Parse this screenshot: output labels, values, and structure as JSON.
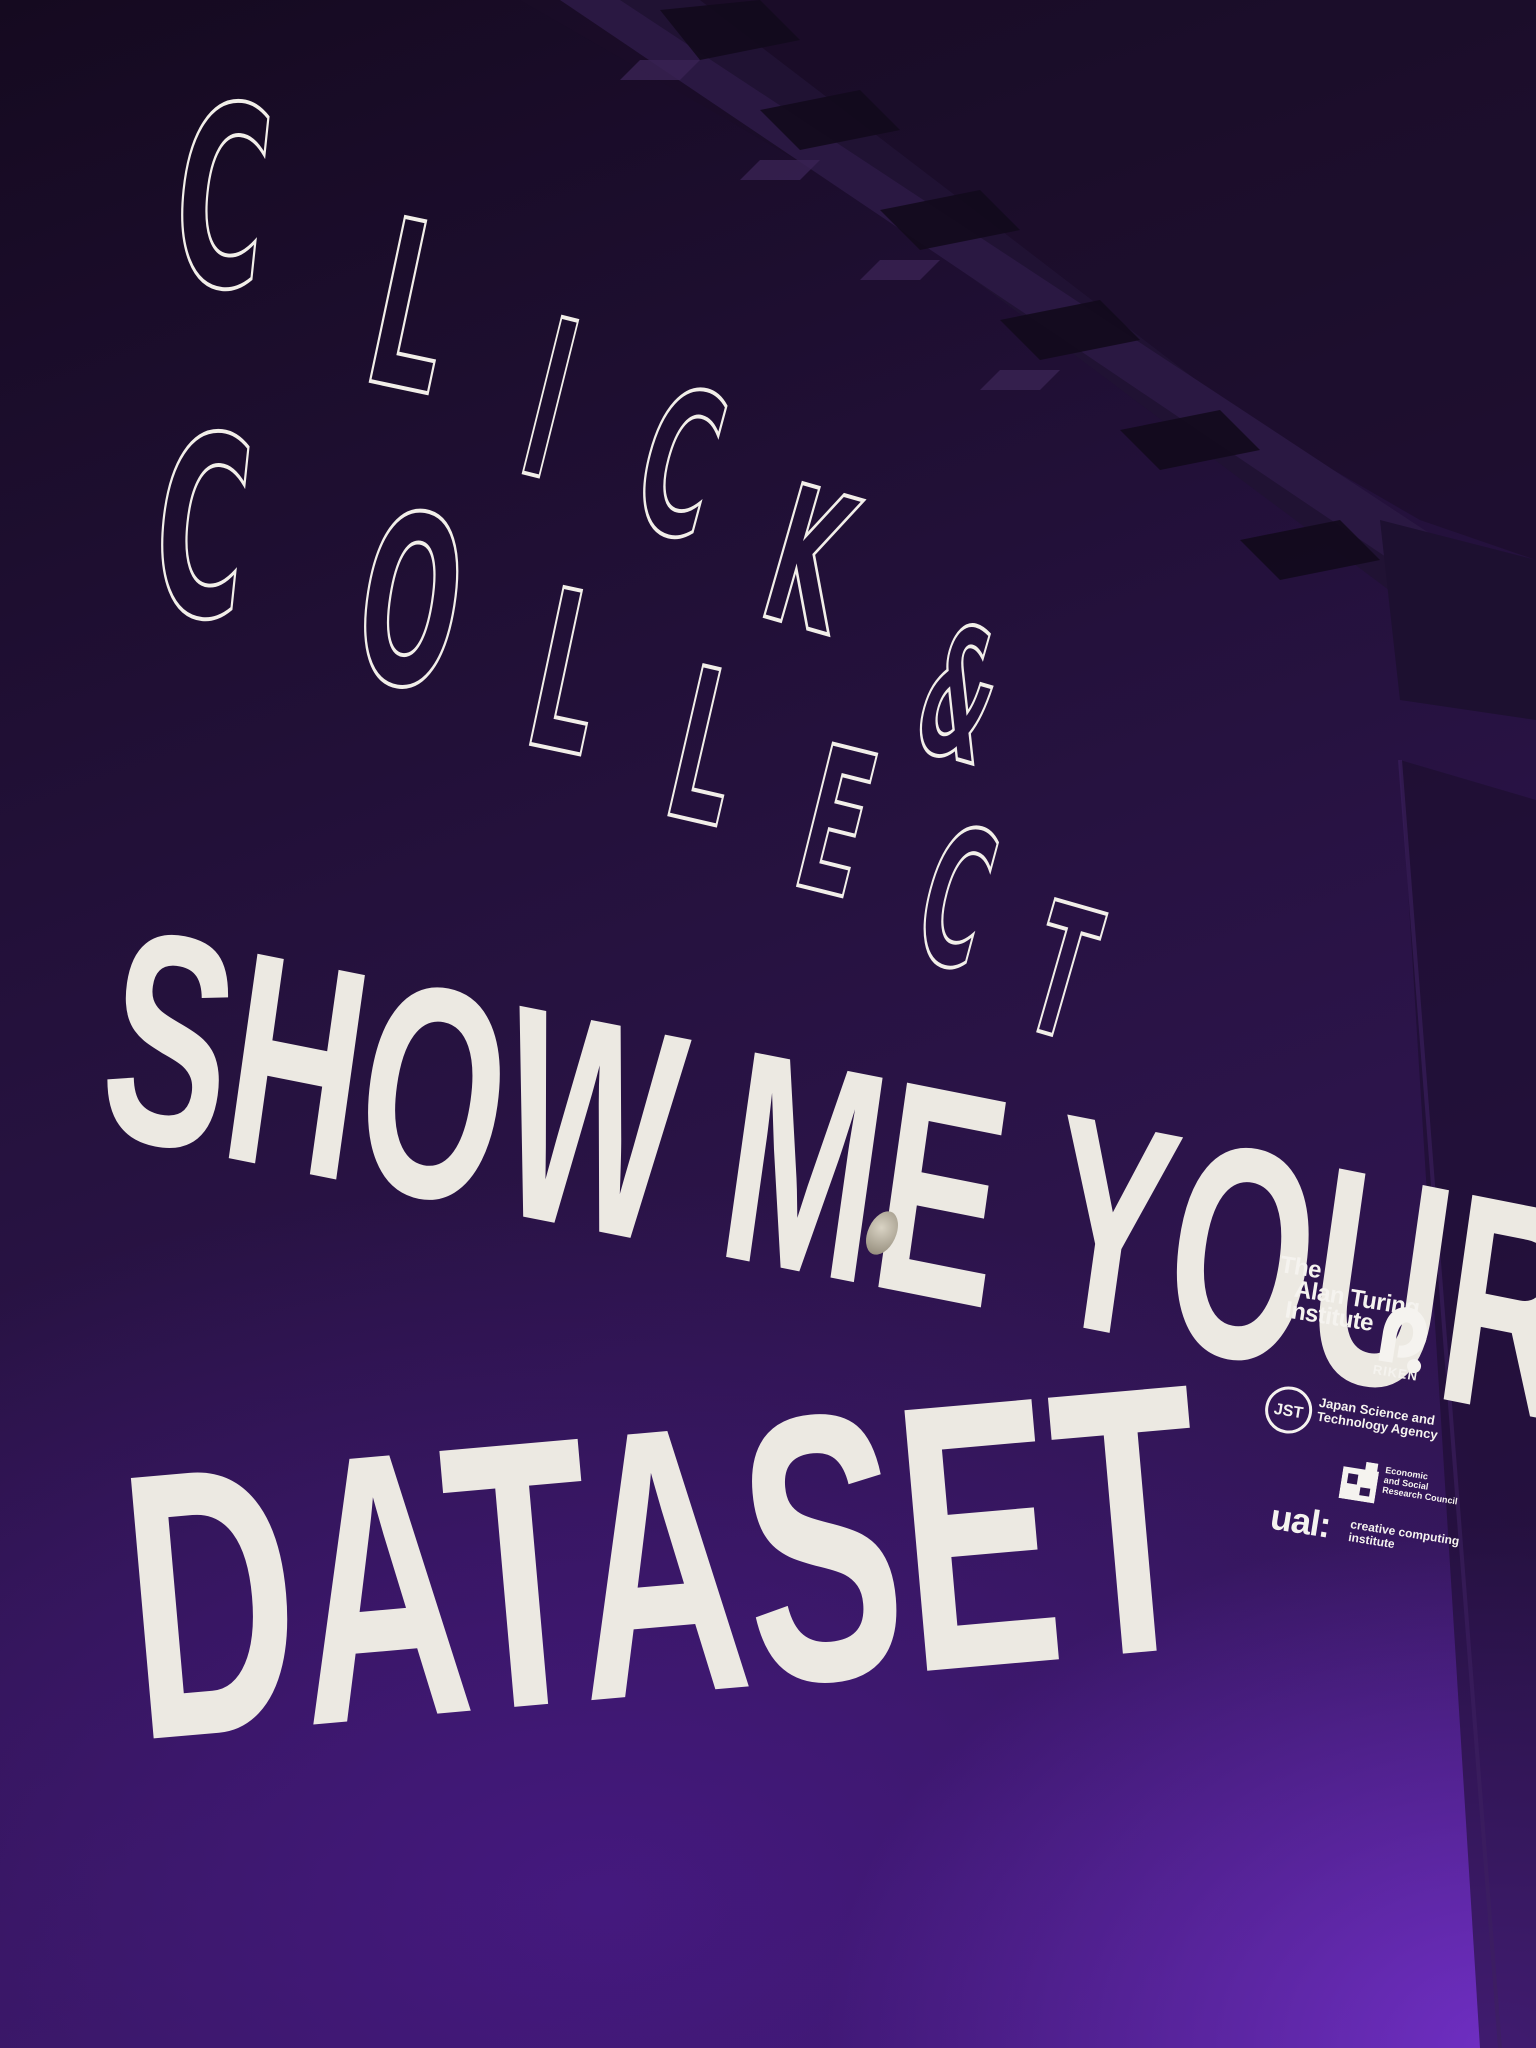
{
  "headline": {
    "outline_line1": [
      "C",
      "L",
      "I",
      "C",
      "K",
      "&"
    ],
    "outline_line2": [
      "C",
      "O",
      "L",
      "L",
      "E",
      "C",
      "T"
    ],
    "solid_line1": "SHOW ME YOUR",
    "solid_line2": "DATASET"
  },
  "logos": {
    "turing": [
      "The",
      "Alan Turing",
      "Institute"
    ],
    "riken": "RIKEN",
    "jst_mark": "JST",
    "jst": [
      "Japan Science and",
      "Technology Agency"
    ],
    "esrc": [
      "Economic",
      "and Social",
      "Research Council"
    ],
    "ual_mark": "ual:",
    "ual": [
      "creative computing",
      "institute"
    ]
  },
  "colors": {
    "background": "#2f1550",
    "text": "#ece9e2",
    "accent_glow": "#7832d2"
  }
}
